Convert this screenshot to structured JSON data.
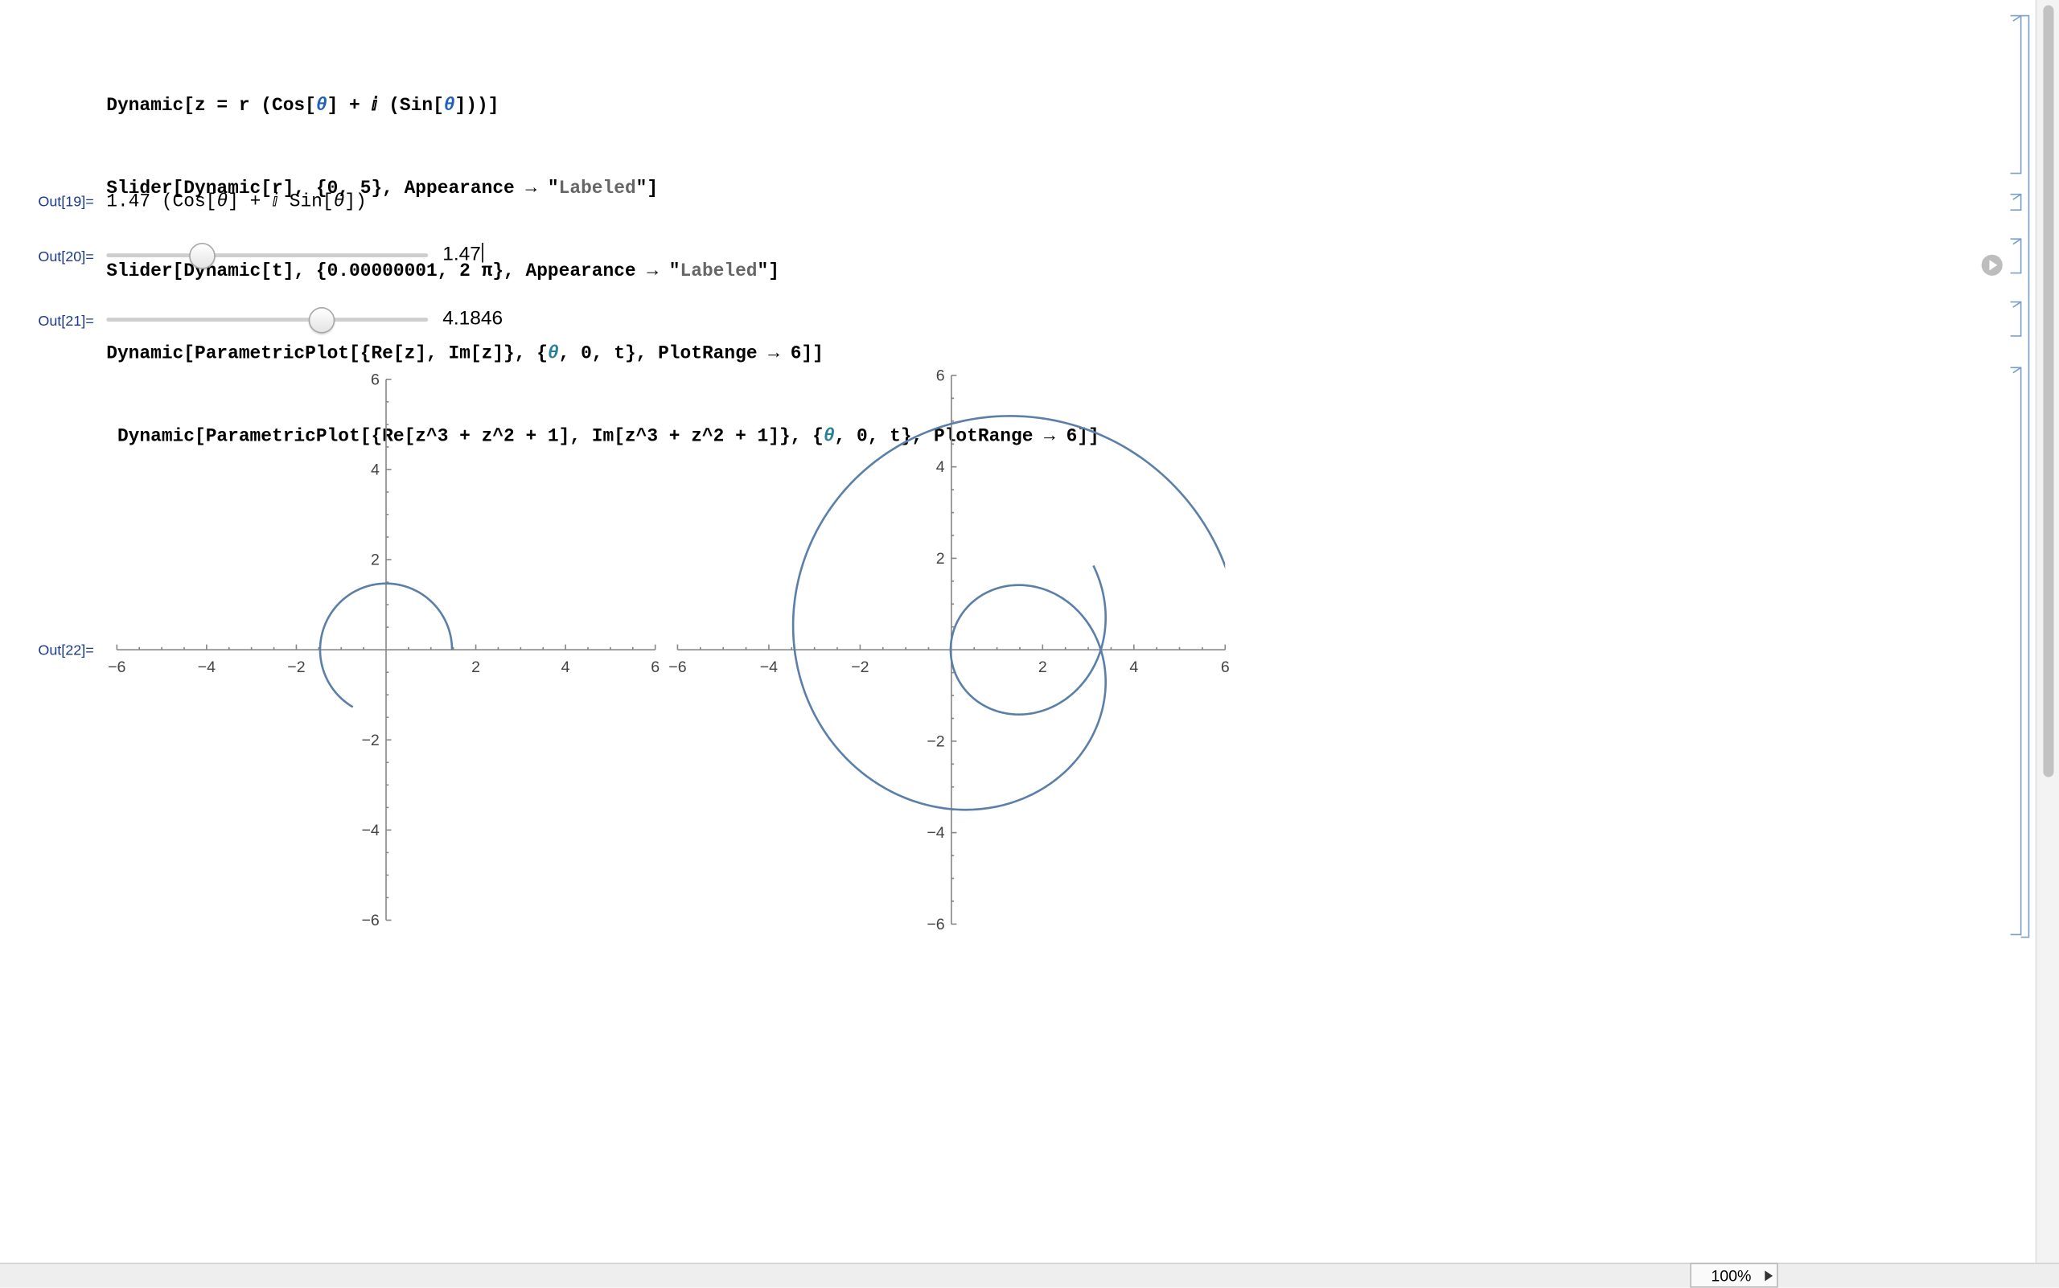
{
  "input": {
    "lines": [
      {
        "segs": [
          {
            "t": "Dynamic[z = r (Cos["
          },
          {
            "t": "θ",
            "c": "sym"
          },
          {
            "t": "] + ⅈ (Sin["
          },
          {
            "t": "θ",
            "c": "sym"
          },
          {
            "t": "]))]"
          }
        ]
      },
      {
        "segs": [
          {
            "t": "Slider[Dynamic[r], {0, 5}, Appearance → \""
          },
          {
            "t": "Labeled",
            "c": "str"
          },
          {
            "t": "\"]"
          }
        ]
      },
      {
        "segs": [
          {
            "t": "Slider[Dynamic[t], {0.00000001, 2 π}, Appearance → \""
          },
          {
            "t": "Labeled",
            "c": "str"
          },
          {
            "t": "\"]"
          }
        ]
      },
      {
        "segs": [
          {
            "t": "Dynamic[ParametricPlot[{Re[z], Im[z]}, {"
          },
          {
            "t": "θ",
            "c": "sym2"
          },
          {
            "t": ", 0, t}, PlotRange → 6]]"
          }
        ]
      },
      {
        "segs": [
          {
            "t": " Dynamic[ParametricPlot[{Re[z^3 + z^2 + 1], Im[z^3 + z^2 + 1]}, {"
          },
          {
            "t": "θ",
            "c": "sym2"
          },
          {
            "t": ", 0, t}, PlotRange → 6]]"
          }
        ]
      }
    ]
  },
  "outputs": {
    "out19": {
      "label": "Out[19]=",
      "segs": [
        {
          "t": "1.47 (Cos["
        },
        {
          "t": "θ",
          "c": "it"
        },
        {
          "t": "] + ⅈ Sin["
        },
        {
          "t": "θ",
          "c": "it"
        },
        {
          "t": "])"
        }
      ]
    },
    "out20": {
      "label": "Out[20]=",
      "value": "1.47"
    },
    "out21": {
      "label": "Out[21]=",
      "value": "4.1846"
    },
    "out22": {
      "label": "Out[22]="
    }
  },
  "sliders": {
    "r": {
      "min": 0,
      "max": 5,
      "value": 1.47
    },
    "t": {
      "min": 1e-08,
      "max": 6.283185307,
      "value": 4.1846
    }
  },
  "chart_data": [
    {
      "type": "line",
      "name": "ParametricPlot[{Re[z], Im[z]}]",
      "expression": "z = 1.47 (Cos[θ] + ⅈ Sin[θ])",
      "theta_range": [
        0,
        4.1846
      ],
      "xlim": [
        -6,
        6
      ],
      "ylim": [
        -6,
        6
      ],
      "x_ticks": [
        -6,
        -4,
        -2,
        2,
        4,
        6
      ],
      "y_ticks": [
        -6,
        -4,
        -2,
        2,
        4,
        6
      ],
      "color": "#5b7fa8"
    },
    {
      "type": "line",
      "name": "ParametricPlot[{Re[z^3 + z^2 + 1], Im[z^3 + z^2 + 1]}]",
      "expression": "z^3 + z^2 + 1",
      "theta_range": [
        0,
        4.1846
      ],
      "xlim": [
        -6,
        6
      ],
      "ylim": [
        -6,
        6
      ],
      "x_ticks": [
        -6,
        -4,
        -2,
        2,
        4,
        6
      ],
      "y_ticks": [
        -6,
        -4,
        -2,
        2,
        4,
        6
      ],
      "color": "#5b7fa8"
    }
  ],
  "status": {
    "zoom": "100%"
  }
}
